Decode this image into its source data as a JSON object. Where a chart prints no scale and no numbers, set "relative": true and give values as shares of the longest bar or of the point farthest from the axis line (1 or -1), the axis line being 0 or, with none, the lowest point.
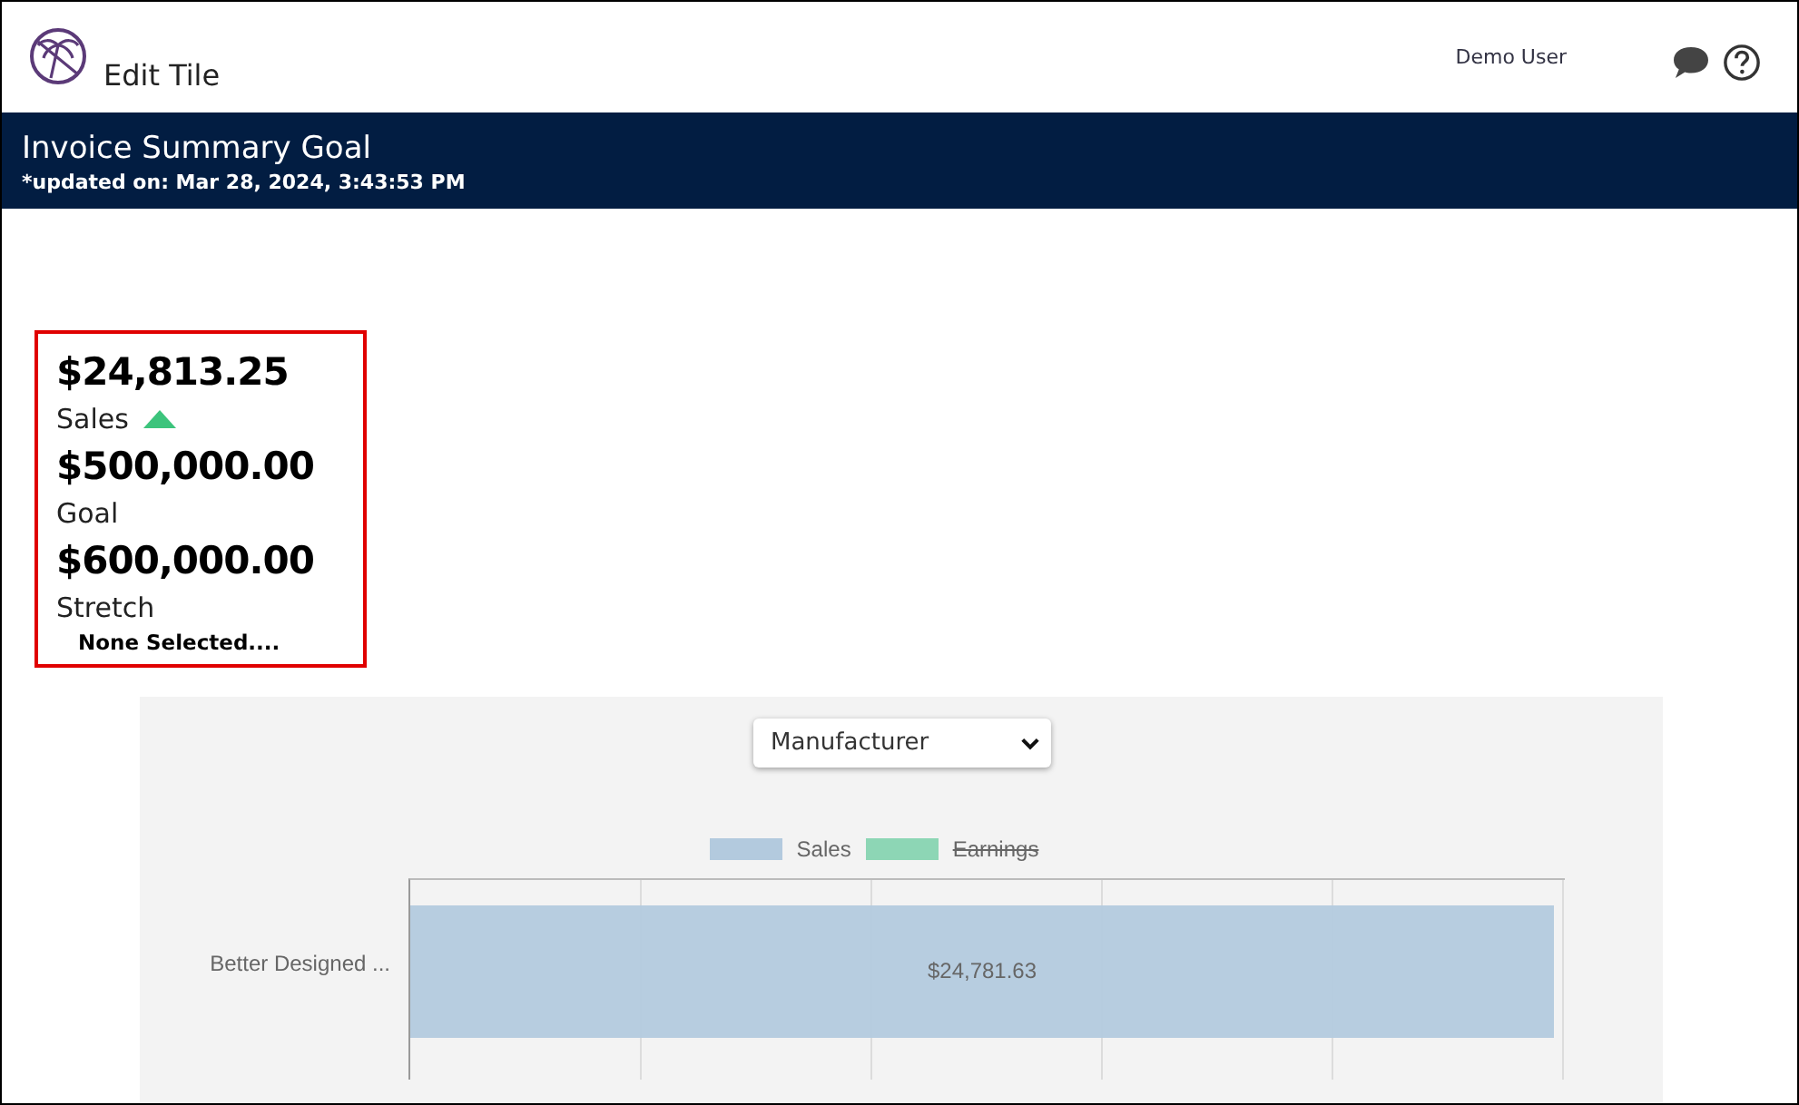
{
  "header": {
    "title": "Edit Tile",
    "user": "Demo User"
  },
  "banner": {
    "title": "Invoice Summary Goal",
    "updated": "*updated on: Mar 28, 2024, 3:43:53 PM"
  },
  "summary": {
    "metrics": [
      {
        "value": "$24,813.25",
        "label": "Sales",
        "up_arrow": true
      },
      {
        "value": "$500,000.00",
        "label": "Goal",
        "up_arrow": false
      },
      {
        "value": "$600,000.00",
        "label": "Stretch",
        "up_arrow": false
      }
    ],
    "note": "None Selected...."
  },
  "group_select": {
    "value": "Manufacturer"
  },
  "legend": {
    "struck": [
      false,
      true
    ]
  },
  "chart_data": {
    "type": "bar",
    "orientation": "horizontal",
    "categories": [
      "Better Designed ..."
    ],
    "series": [
      {
        "name": "Sales",
        "color": "#b3cade",
        "values": [
          1
        ]
      },
      {
        "name": "Earnings",
        "color": "#8dd6b5",
        "values": [
          null
        ]
      }
    ],
    "value_labels": [
      "$24,781.63"
    ],
    "relative": true
  }
}
